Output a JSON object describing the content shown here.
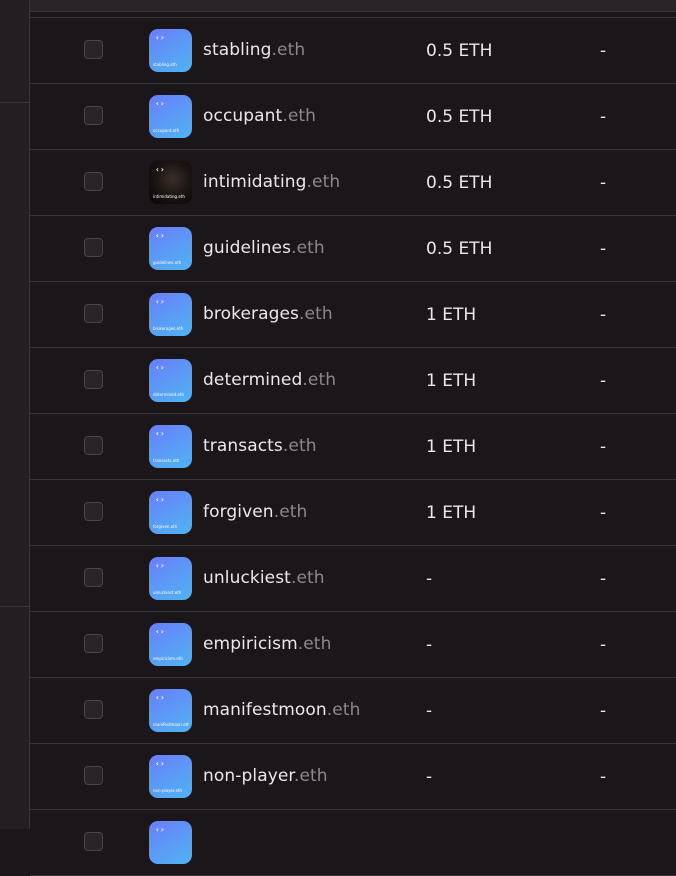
{
  "rows": [
    {
      "label": "stabling",
      "tld": ".eth",
      "price": "0.5 ETH",
      "extra": "-",
      "avatar_text": "stabling.eth",
      "avatar": "blue-gradient"
    },
    {
      "label": "occupant",
      "tld": ".eth",
      "price": "0.5 ETH",
      "extra": "-",
      "avatar_text": "occupant.eth",
      "avatar": "blue-gradient"
    },
    {
      "label": "intimidating",
      "tld": ".eth",
      "price": "0.5 ETH",
      "extra": "-",
      "avatar_text": "intimidating.eth",
      "avatar": "photo"
    },
    {
      "label": "guidelines",
      "tld": ".eth",
      "price": "0.5 ETH",
      "extra": "-",
      "avatar_text": "guidelines.eth",
      "avatar": "blue-gradient"
    },
    {
      "label": "brokerages",
      "tld": ".eth",
      "price": "1 ETH",
      "extra": "-",
      "avatar_text": "brokerages.eth",
      "avatar": "blue-gradient"
    },
    {
      "label": "determined",
      "tld": ".eth",
      "price": "1 ETH",
      "extra": "-",
      "avatar_text": "determined.eth",
      "avatar": "blue-gradient"
    },
    {
      "label": "transacts",
      "tld": ".eth",
      "price": "1 ETH",
      "extra": "-",
      "avatar_text": "transacts.eth",
      "avatar": "blue-gradient"
    },
    {
      "label": "forgiven",
      "tld": ".eth",
      "price": "1 ETH",
      "extra": "-",
      "avatar_text": "forgiven.eth",
      "avatar": "blue-gradient"
    },
    {
      "label": "unluckiest",
      "tld": ".eth",
      "price": "-",
      "extra": "-",
      "avatar_text": "unluckiest.eth",
      "avatar": "blue-gradient"
    },
    {
      "label": "empiricism",
      "tld": ".eth",
      "price": "-",
      "extra": "-",
      "avatar_text": "empiricism.eth",
      "avatar": "blue-gradient"
    },
    {
      "label": "manifestmoon",
      "tld": ".eth",
      "price": "-",
      "extra": "-",
      "avatar_text": "manifestmoon.eth",
      "avatar": "blue-gradient"
    },
    {
      "label": "non-player",
      "tld": ".eth",
      "price": "-",
      "extra": "-",
      "avatar_text": "non-player.eth",
      "avatar": "blue-gradient"
    },
    {
      "label": "",
      "tld": "",
      "price": "",
      "extra": "",
      "avatar_text": "",
      "avatar": "blue-gradient"
    }
  ],
  "avatar_glyph": "‹›",
  "colors": {
    "background": "#1b1619",
    "tld": "#8e878b",
    "avatar_gradient_start": "#6a7dfc",
    "avatar_gradient_end": "#4fb4f1"
  }
}
